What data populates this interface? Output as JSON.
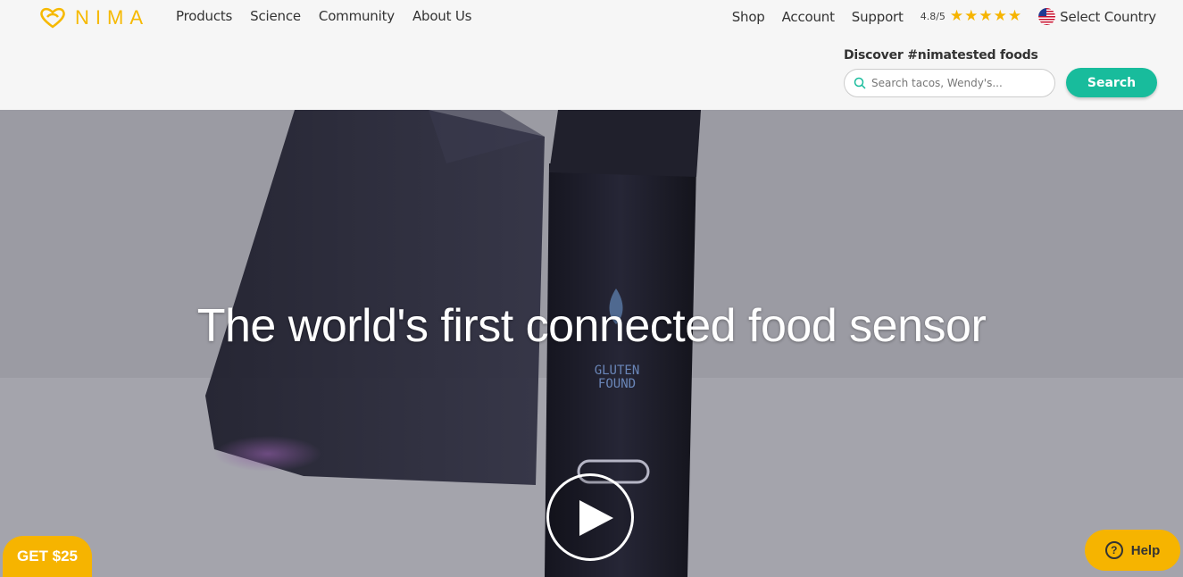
{
  "brand": {
    "name": "NIMA",
    "color": "#f6b900"
  },
  "nav": {
    "left": [
      "Products",
      "Science",
      "Community",
      "About Us"
    ],
    "shop": "Shop",
    "account": "Account",
    "support": "Support",
    "rating": "4.8/5",
    "rating_stars": 5,
    "country": "Select Country"
  },
  "search": {
    "heading": "Discover #nimatested foods",
    "placeholder": "Search tacos, Wendy's...",
    "value": "",
    "button": "Search",
    "button_color": "#18bc9c"
  },
  "hero": {
    "title": "The world's first connected food sensor",
    "play_icon": "play-icon"
  },
  "floating": {
    "get": "GET $25",
    "help": "Help",
    "help_icon_char": "?",
    "accent": "#f6b400"
  }
}
